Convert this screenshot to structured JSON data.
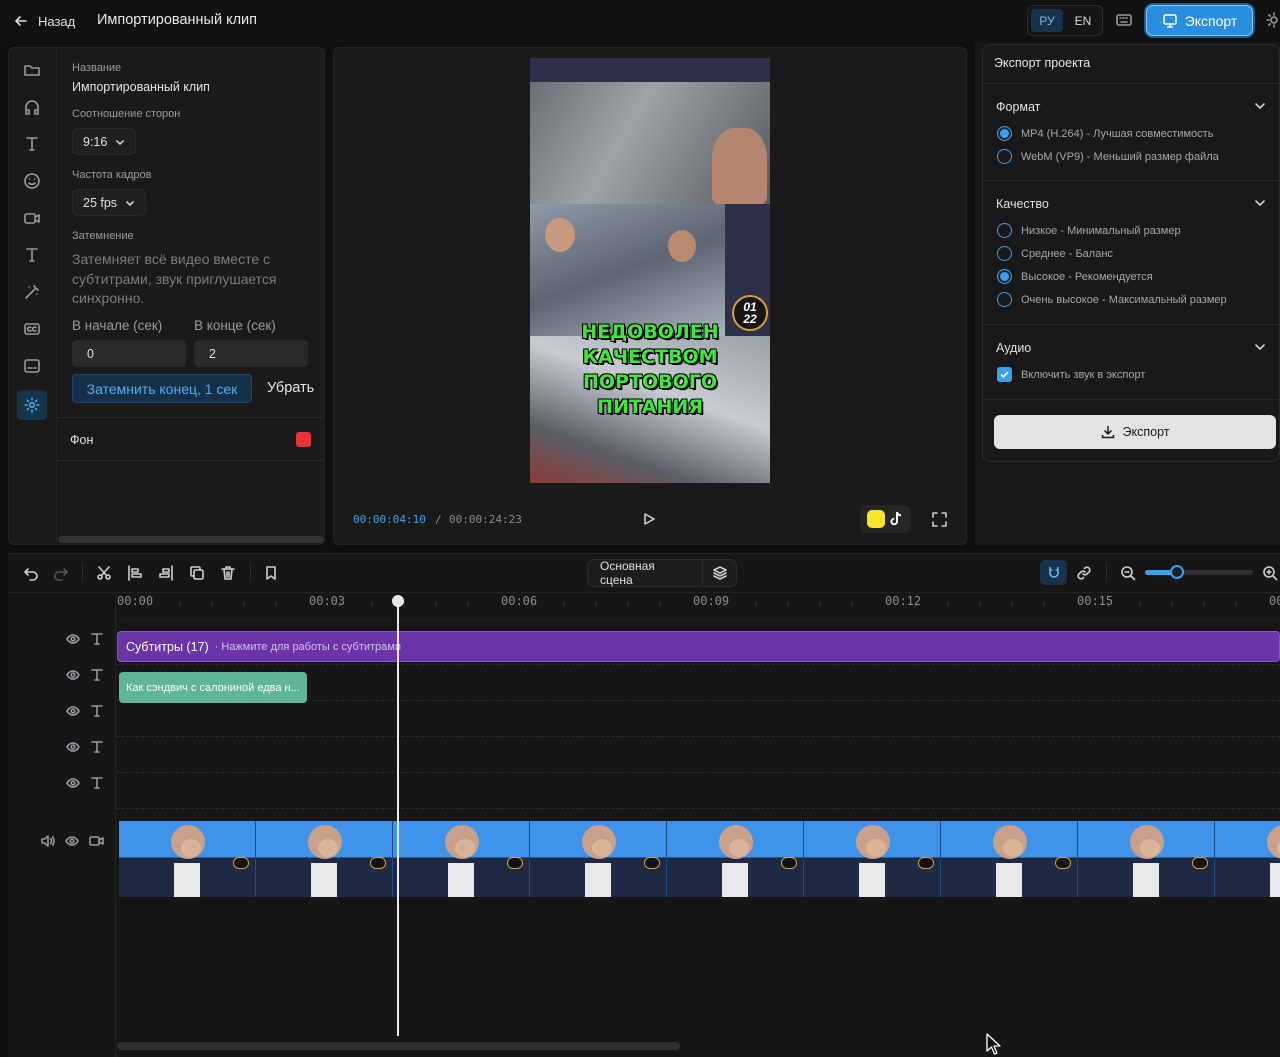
{
  "header": {
    "back_label": "Назад",
    "title": "Импортированный клип",
    "lang_ru": "РУ",
    "lang_en": "EN",
    "export_label": "Экспорт",
    "accent_color": "#2a8ee0"
  },
  "left_panel": {
    "name_label": "Название",
    "name_value": "Импортированный клип",
    "aspect_label": "Соотношение сторон",
    "aspect_value": "9:16",
    "fps_label": "Частота кадров",
    "fps_value": "25 fps",
    "fade_label": "Затемнение",
    "fade_desc": "Затемняет всё видео вместе с субтитрами, звук приглушается синхронно.",
    "start_label": "В начале (сек)",
    "end_label": "В конце (сек)",
    "start_value": "0",
    "end_value": "2",
    "fade_end_button": "Затемнить конец, 1 сек",
    "remove_button": "Убрать",
    "bg_label": "Фон",
    "bg_color": "#e8333a"
  },
  "preview": {
    "current_time": "00:00:04:10",
    "separator": "/",
    "total_time": "00:00:24:23",
    "overlay_text_lines": [
      "НЕДОВОЛЕН",
      "КАЧЕСТВОМ",
      "ПОРТОВОГО",
      "ПИТАНИЯ"
    ],
    "badge_top": "01",
    "badge_bottom": "22"
  },
  "export_panel": {
    "title": "Экспорт проекта",
    "format_title": "Формат",
    "formats": [
      {
        "label": "MP4 (H.264) - Лучшая совместимость",
        "selected": true
      },
      {
        "label": "WebM (VP9) - Меньший размер файла",
        "selected": false
      }
    ],
    "quality_title": "Качество",
    "qualities": [
      {
        "label": "Низкое - Минимальный размер",
        "selected": false
      },
      {
        "label": "Среднее - Баланс",
        "selected": false
      },
      {
        "label": "Высокое - Рекомендуется",
        "selected": true
      },
      {
        "label": "Очень высокое - Максимальный размер",
        "selected": false
      }
    ],
    "audio_title": "Аудио",
    "audio_checkbox": "Включить звук в экспорт",
    "audio_checked": true,
    "export_button": "Экспорт"
  },
  "timeline": {
    "scene_label": "Основная сцена",
    "ticks": [
      "00:00",
      "00:03",
      "00:06",
      "00:09",
      "00:12",
      "00:15",
      "00"
    ],
    "subtitle_track_label": "Субтитры (17)",
    "subtitle_track_hint": "· Нажмите для работы с субтитрами",
    "subtitle_clip_text": "Как сэндвич с салониной едва н...",
    "subtitle_color": "#6b35a8",
    "clip_color": "#5fb598",
    "zoom_level": 0.3,
    "playhead_time": "00:00:04:10"
  }
}
